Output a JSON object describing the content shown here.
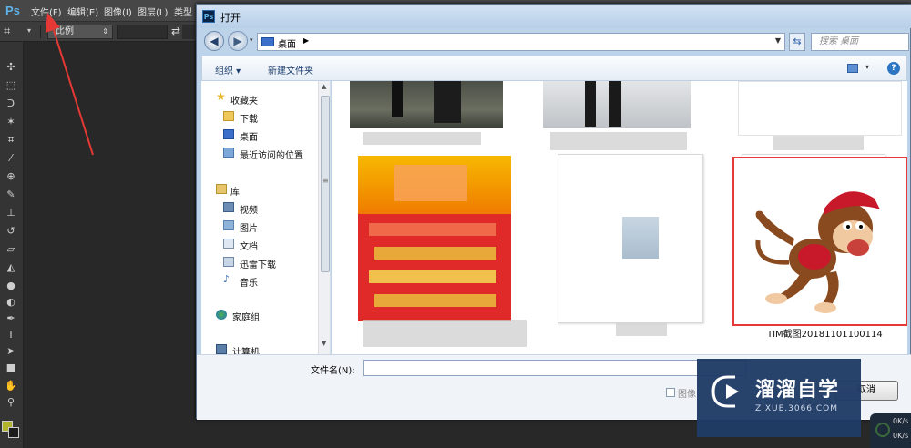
{
  "photoshop": {
    "logo": "Ps",
    "menu": [
      "文件(F)",
      "编辑(E)",
      "图像(I)",
      "图层(L)",
      "类型"
    ],
    "options": {
      "select_value": "比例",
      "swap_icon": "swap-arrows-icon"
    }
  },
  "annotation": {
    "color": "#e53935",
    "points_to": "文件(F)"
  },
  "dialog": {
    "title_icon": "Ps",
    "title": "打开",
    "address": {
      "location": "桌面",
      "search_placeholder": "搜索 桌面"
    },
    "commandbar": {
      "organize": "组织 ▾",
      "new_folder": "新建文件夹"
    },
    "nav": [
      {
        "label": "收藏夹",
        "icon": "star-icon"
      },
      {
        "label": "下载",
        "icon": "download-folder-icon"
      },
      {
        "label": "桌面",
        "icon": "desktop-icon"
      },
      {
        "label": "最近访问的位置",
        "icon": "recent-places-icon"
      },
      {
        "label": "库",
        "icon": "library-icon"
      },
      {
        "label": "视频",
        "icon": "video-library-icon"
      },
      {
        "label": "图片",
        "icon": "picture-library-icon"
      },
      {
        "label": "文档",
        "icon": "document-library-icon"
      },
      {
        "label": "迅雷下载",
        "icon": "thunder-download-icon"
      },
      {
        "label": "音乐",
        "icon": "music-library-icon"
      },
      {
        "label": "家庭组",
        "icon": "homegroup-icon"
      },
      {
        "label": "计算机",
        "icon": "computer-icon"
      }
    ],
    "files": [
      {
        "name": "",
        "kind": "photo-top-1"
      },
      {
        "name": "",
        "kind": "photo-top-2"
      },
      {
        "name": "",
        "kind": "blank-top-3"
      },
      {
        "name": "",
        "kind": "poster"
      },
      {
        "name": "",
        "kind": "document"
      },
      {
        "name": "TIM截图20181101100114",
        "kind": "monkey-image",
        "selected": true
      }
    ],
    "filename_label": "文件名(N):",
    "filename_value": "",
    "image_sequence_label": "图像",
    "cancel_label": "取消"
  },
  "watermark": {
    "text": "溜溜自学",
    "url": "ZIXUE.3066.COM"
  },
  "netspeed": {
    "up": "0K/s",
    "down": "0K/s"
  },
  "colors": {
    "ps_bg": "#282828",
    "selection_border": "#e53935",
    "watermark_bg": "#1f3b66"
  }
}
